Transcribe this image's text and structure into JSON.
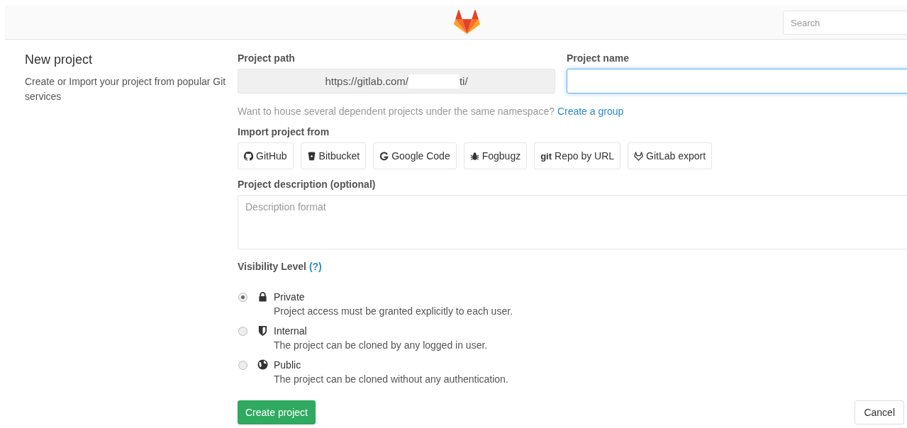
{
  "header": {
    "search": {
      "placeholder": "Search"
    }
  },
  "intro": {
    "title": "New project",
    "description": "Create or Import your project from popular Git services"
  },
  "project_path": {
    "label": "Project path",
    "prefix": "https://gitlab.com/",
    "suffix": "ti/",
    "redacted": true
  },
  "project_name": {
    "label": "Project name",
    "focused": true
  },
  "group_hint": {
    "text": "Want to house several dependent projects under the same namespace?",
    "link": "Create a group"
  },
  "import": {
    "label": "Import project from",
    "sources": [
      {
        "kind": "github",
        "label": "GitHub"
      },
      {
        "kind": "bitbucket",
        "label": "Bitbucket"
      },
      {
        "kind": "google",
        "label": "Google Code"
      },
      {
        "kind": "fogbugz",
        "label": "Fogbugz"
      },
      {
        "kind": "git",
        "label": "Repo by URL",
        "mark": "git"
      },
      {
        "kind": "gitlab",
        "label": "GitLab export"
      }
    ]
  },
  "description": {
    "label": "Project description (optional)",
    "placeholder": "Description format"
  },
  "visibility": {
    "label": "Visibility Level",
    "help": "(?)",
    "options": [
      {
        "kind": "lock",
        "label": "Private",
        "detail": "Project access must be granted explicitly to each user.",
        "selected": true
      },
      {
        "kind": "shield",
        "label": "Internal",
        "detail": "The project can be cloned by any logged in user.",
        "selected": false
      },
      {
        "kind": "globe",
        "label": "Public",
        "detail": "The project can be cloned without any authentication.",
        "selected": false
      }
    ]
  },
  "buttons": {
    "create": "Create project",
    "cancel": "Cancel"
  }
}
